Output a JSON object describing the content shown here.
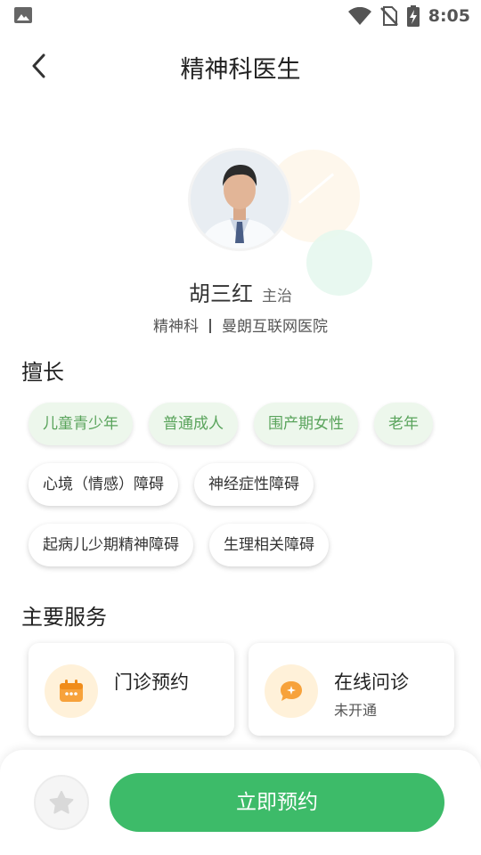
{
  "status_bar": {
    "time": "8:05",
    "icons": [
      "image-icon",
      "wifi-icon",
      "no-sim-icon",
      "battery-charging-icon"
    ]
  },
  "header": {
    "title": "精神科医生",
    "back_icon": "chevron-left-icon"
  },
  "doctor": {
    "name": "胡三红",
    "rank": "主治",
    "department": "精神科",
    "hospital": "曼朗互联网医院"
  },
  "specialties": {
    "title": "擅长",
    "groups": [
      {
        "label": "儿童青少年",
        "highlighted": true
      },
      {
        "label": "普通成人",
        "highlighted": true
      },
      {
        "label": "围产期女性",
        "highlighted": true
      },
      {
        "label": "老年",
        "highlighted": true
      }
    ],
    "conditions": [
      {
        "label": "心境（情感）障碍"
      },
      {
        "label": "神经症性障碍"
      },
      {
        "label": "起病儿少期精神障碍"
      },
      {
        "label": "生理相关障碍"
      }
    ]
  },
  "services": {
    "title": "主要服务",
    "items": [
      {
        "label": "门诊预约",
        "sub": "",
        "icon": "calendar-icon"
      },
      {
        "label": "在线问诊",
        "sub": "未开通",
        "icon": "chat-bubble-icon"
      }
    ]
  },
  "bottom": {
    "book_label": "立即预约",
    "favorite_icon": "star-icon"
  },
  "colors": {
    "primary_green": "#3dbb69",
    "tag_green_text": "#5aa45c",
    "tag_green_bg": "#edf7ec",
    "icon_orange": "#f7a23b"
  }
}
